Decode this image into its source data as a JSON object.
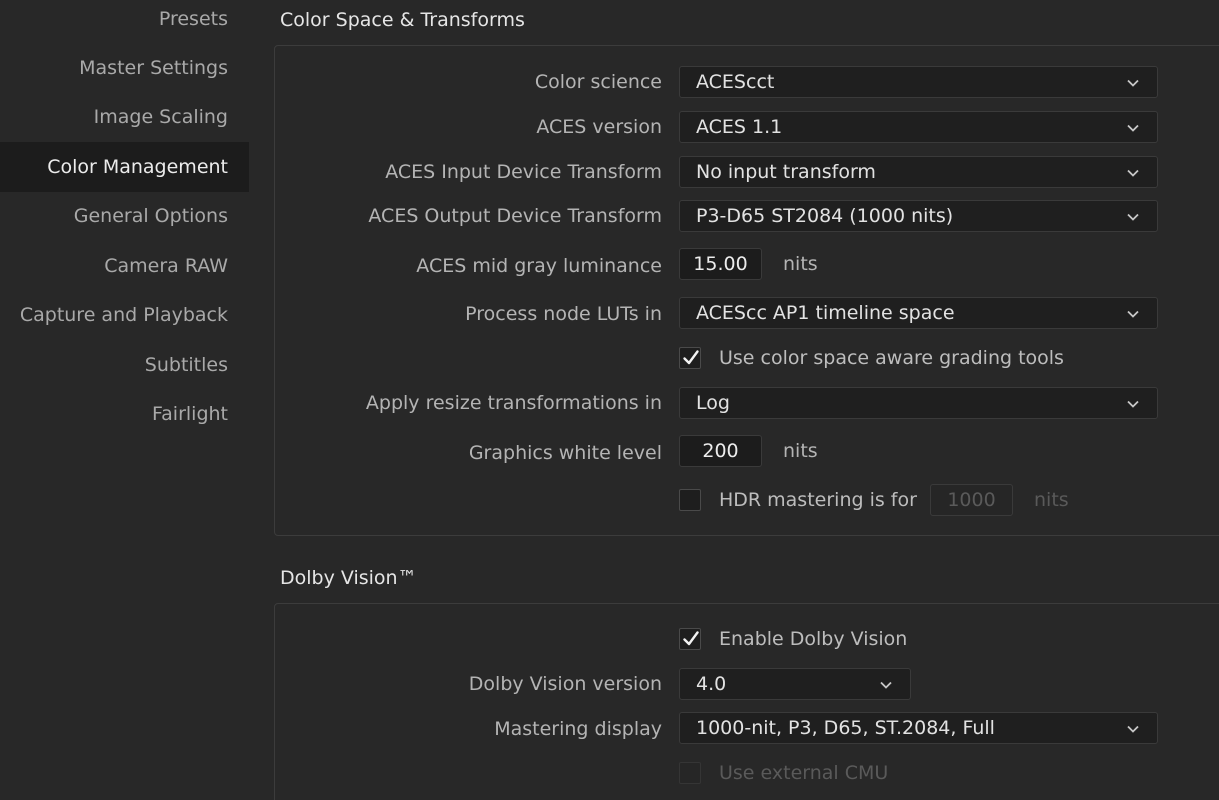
{
  "sidebar": {
    "items": [
      {
        "label": "Presets"
      },
      {
        "label": "Master Settings"
      },
      {
        "label": "Image Scaling"
      },
      {
        "label": "Color Management"
      },
      {
        "label": "General Options"
      },
      {
        "label": "Camera RAW"
      },
      {
        "label": "Capture and Playback"
      },
      {
        "label": "Subtitles"
      },
      {
        "label": "Fairlight"
      }
    ],
    "active": "Color Management"
  },
  "color_space": {
    "title": "Color Space & Transforms",
    "color_science": {
      "label": "Color science",
      "value": "ACEScct"
    },
    "aces_version": {
      "label": "ACES version",
      "value": "ACES 1.1"
    },
    "input_transform": {
      "label": "ACES Input Device Transform",
      "value": "No input transform"
    },
    "output_transform": {
      "label": "ACES Output Device Transform",
      "value": "P3-D65 ST2084 (1000 nits)"
    },
    "mid_gray": {
      "label": "ACES mid gray luminance",
      "value": "15.00",
      "unit": "nits"
    },
    "process_luts": {
      "label": "Process node LUTs in",
      "value": "ACEScc AP1 timeline space"
    },
    "aware_tools": {
      "label": "Use color space aware grading tools",
      "checked": true
    },
    "resize": {
      "label": "Apply resize transformations in",
      "value": "Log"
    },
    "graphics_white": {
      "label": "Graphics white level",
      "value": "200",
      "unit": "nits"
    },
    "hdr_mastering": {
      "label": "HDR mastering is for",
      "value": "1000",
      "unit": "nits",
      "checked": false
    }
  },
  "dolby": {
    "title": "Dolby Vision™",
    "enable": {
      "label": "Enable Dolby Vision",
      "checked": true
    },
    "version": {
      "label": "Dolby Vision version",
      "value": "4.0"
    },
    "mastering_display": {
      "label": "Mastering display",
      "value": "1000-nit, P3, D65, ST.2084, Full"
    },
    "external_cmu": {
      "label": "Use external CMU",
      "checked": false
    }
  }
}
